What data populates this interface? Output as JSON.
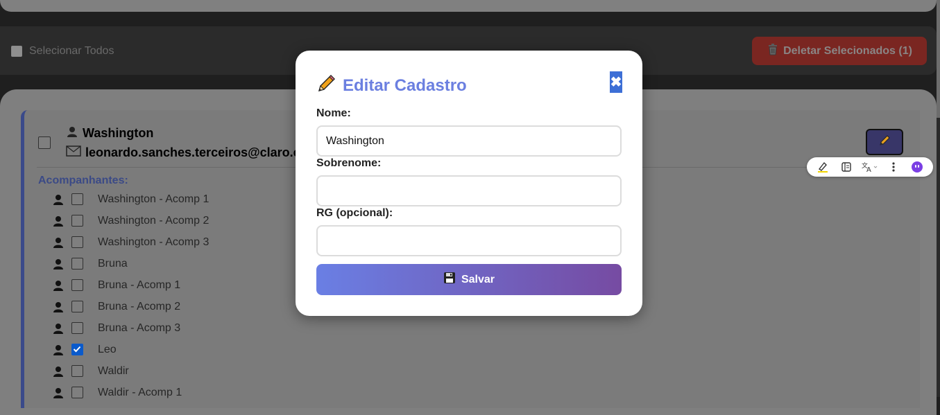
{
  "toolbar": {
    "select_all_label": "Selecionar Todos",
    "delete_label": "Deletar Selecionados (1)"
  },
  "user": {
    "name": "Washington",
    "email": "leonardo.sanches.terceiros@claro.c"
  },
  "acompanhantes": {
    "title": "Acompanhantes:",
    "items": [
      {
        "label": "Washington - Acomp 1",
        "checked": false
      },
      {
        "label": "Washington - Acomp 2",
        "checked": false
      },
      {
        "label": "Washington - Acomp 3",
        "checked": false
      },
      {
        "label": "Bruna",
        "checked": false
      },
      {
        "label": "Bruna - Acomp 1",
        "checked": false
      },
      {
        "label": "Bruna - Acomp 2",
        "checked": false
      },
      {
        "label": "Bruna - Acomp 3",
        "checked": false
      },
      {
        "label": "Leo",
        "checked": true
      },
      {
        "label": "Waldir",
        "checked": false
      },
      {
        "label": "Waldir - Acomp 1",
        "checked": false
      }
    ]
  },
  "modal": {
    "title": "Editar Cadastro",
    "close_label": "✖",
    "nome_label": "Nome:",
    "nome_value": "Washington",
    "sobrenome_label": "Sobrenome:",
    "sobrenome_value": "",
    "rg_label": "RG (opcional):",
    "rg_value": "",
    "save_label": "Salvar"
  },
  "colors": {
    "accent": "#6b7fe0",
    "gradient_start": "#6a7fe4",
    "gradient_end": "#764ba2",
    "delete": "#7a2621",
    "close": "#3d6fd6"
  }
}
